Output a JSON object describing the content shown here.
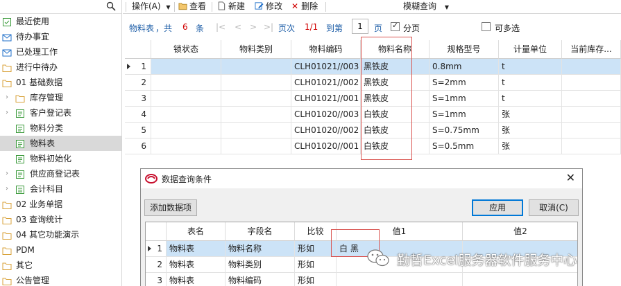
{
  "sidebar": {
    "search_icon": "search-icon",
    "items": [
      {
        "label": "最近使用",
        "icon": "note-icon",
        "level": 0
      },
      {
        "label": "待办事宜",
        "icon": "mail-icon",
        "level": 0
      },
      {
        "label": "已处理工作",
        "icon": "mail-icon",
        "level": 0
      },
      {
        "label": "进行中待办",
        "icon": "folder-icon",
        "level": 0
      },
      {
        "label": "01 基础数据",
        "icon": "folder-icon",
        "level": 0
      },
      {
        "label": "库存管理",
        "icon": "folder-icon",
        "level": 1,
        "chevron": "›"
      },
      {
        "label": "客户登记表",
        "icon": "form-icon",
        "level": 1,
        "chevron": "›"
      },
      {
        "label": "物料分类",
        "icon": "form-icon",
        "level": 1
      },
      {
        "label": "物料表",
        "icon": "form-icon",
        "level": 1,
        "selected": true
      },
      {
        "label": "物料初始化",
        "icon": "form-icon",
        "level": 1
      },
      {
        "label": "供应商登记表",
        "icon": "form-icon",
        "level": 1,
        "chevron": "›"
      },
      {
        "label": "会计科目",
        "icon": "list-icon",
        "level": 1,
        "chevron": "›"
      },
      {
        "label": "02 业务单据",
        "icon": "folder-icon",
        "level": 0
      },
      {
        "label": "03 查询统计",
        "icon": "folder-icon",
        "level": 0
      },
      {
        "label": "04 其它功能演示",
        "icon": "folder-icon",
        "level": 0
      },
      {
        "label": "PDM",
        "icon": "folder-icon",
        "level": 0
      },
      {
        "label": "其它",
        "icon": "folder-icon",
        "level": 0
      },
      {
        "label": "公告管理",
        "icon": "folder-icon",
        "level": 0
      }
    ]
  },
  "toolbar": {
    "ops_label": "操作(A)",
    "view_label": "查看",
    "new_label": "新建",
    "edit_label": "修改",
    "delete_label": "删除",
    "fuzzy_label": "模糊查询"
  },
  "pager": {
    "table_name": "物料表",
    "total_prefix": "，共",
    "count": "6",
    "count_unit": "条",
    "nav_first": "|<",
    "nav_prev": "<",
    "nav_next": ">",
    "nav_last": ">|",
    "page_label": "页次",
    "page_value": "1/1",
    "goto_label": "到第",
    "goto_value": "1",
    "page_unit": "页",
    "paging_label": "分页",
    "paging_checked": true,
    "multiselect_label": "可多选",
    "multiselect_checked": false
  },
  "grid": {
    "columns": [
      "锁状态",
      "物料类别",
      "物料编码",
      "物料名称",
      "规格型号",
      "计量单位",
      "当前库存..."
    ],
    "rows": [
      {
        "n": "1",
        "cells": [
          "",
          "",
          "CLH01021//003",
          "黑铁皮",
          "0.8mm",
          "t",
          ""
        ],
        "selected": true
      },
      {
        "n": "2",
        "cells": [
          "",
          "",
          "CLH01021//002",
          "黑铁皮",
          "S=2mm",
          "t",
          ""
        ]
      },
      {
        "n": "3",
        "cells": [
          "",
          "",
          "CLH01021//001",
          "黑铁皮",
          "S=1mm",
          "t",
          ""
        ]
      },
      {
        "n": "4",
        "cells": [
          "",
          "",
          "CLH01020//003",
          "白铁皮",
          "S=1mm",
          "张",
          ""
        ]
      },
      {
        "n": "5",
        "cells": [
          "",
          "",
          "CLH01020//002",
          "白铁皮",
          "S=0.75mm",
          "张",
          ""
        ]
      },
      {
        "n": "6",
        "cells": [
          "",
          "",
          "CLH01020//001",
          "白铁皮",
          "S=0.5mm",
          "张",
          ""
        ]
      }
    ]
  },
  "dialog": {
    "title": "数据查询条件",
    "add_label": "添加数据项",
    "apply_label": "应用",
    "cancel_label": "取消(C)",
    "columns": [
      "表名",
      "字段名",
      "比较",
      "值1",
      "值2"
    ],
    "rows": [
      {
        "n": "1",
        "cells": [
          "物料表",
          "物料名称",
          "形如",
          "白 黑",
          ""
        ],
        "selected": true
      },
      {
        "n": "2",
        "cells": [
          "物料表",
          "物料类别",
          "形如",
          "",
          ""
        ]
      },
      {
        "n": "3",
        "cells": [
          "物料表",
          "物料编码",
          "形如",
          "",
          ""
        ]
      }
    ]
  },
  "watermark": {
    "text": "勤哲Excel服务器软件服务中心"
  },
  "colors": {
    "selection": "#cce3f7",
    "accent_blue": "#1f5fa8",
    "count_red": "#d00000",
    "highlight_border": "#d9534f"
  }
}
